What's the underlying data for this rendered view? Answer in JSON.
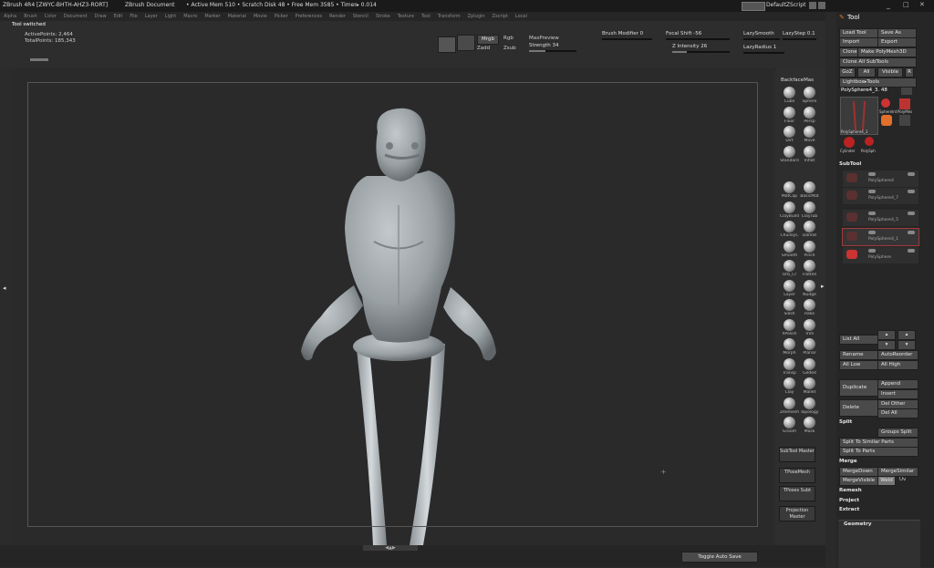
{
  "titlebar": {
    "app": "ZBrush 4R4 [ZWYC-BHTH-AHZ3-RORT]",
    "document": "ZBrush Document",
    "stats": "• Active Mem 510 • Scratch Disk 48 • Free Mem 3585 • Timer▸ 0.014",
    "script_label": "DefaultZScript"
  },
  "menu": [
    "Alpha",
    "Brush",
    "Color",
    "Document",
    "Draw",
    "Edit",
    "File",
    "Layer",
    "Light",
    "Macro",
    "Marker",
    "Material",
    "Movie",
    "Picker",
    "Preferences",
    "Render",
    "Stencil",
    "Stroke",
    "Texture",
    "Tool",
    "Transform",
    "Zplugin",
    "Zscript",
    "Local"
  ],
  "status": {
    "message": "Tool switched",
    "active_points": "ActivePoints: 2,464",
    "total_points": "TotalPoints: 185,343"
  },
  "draw_controls": {
    "mrgb": "Mrgb",
    "rgb": "Rgb",
    "m": "M",
    "zadd": "Zadd",
    "zsub": "Zsub",
    "max_preview": "MaxPreview",
    "strength_label": "Strength",
    "strength_value": "34",
    "brush_modifier_label": "Brush Modifier",
    "brush_modifier_value": "0",
    "focal_shift_label": "Focal Shift",
    "focal_shift_value": "-56",
    "z_intensity_label": "Z Intensity",
    "z_intensity_value": "26",
    "lazy_smooth": "LazySmooth",
    "lazy_step_label": "LazyStep",
    "lazy_step_value": "0.1",
    "lazy_radius_label": "LazyRadius",
    "lazy_radius_value": "1",
    "strength_level": 0.34,
    "z_intensity_level": 0.26
  },
  "materials": {
    "header": "BackfaceMas",
    "items": [
      "Cube",
      "Sphere",
      "Floor",
      "Persp",
      "Dirt",
      "Move",
      "Standard",
      "Inflat",
      "MatCap",
      "BasicMat",
      "ClayBuild",
      "ClayTub",
      "ChunkyC",
      "DamSt",
      "Smooth",
      "Pinch",
      "Orb_Cr",
      "Flatten",
      "Layer",
      "Nudge",
      "Slash",
      "Rake",
      "hPolish",
      "Trim",
      "Morph",
      "Planar",
      "Transp",
      "Gilded",
      "Clay",
      "Mallet",
      "ZRemesh",
      "Topology",
      "Groom",
      "Mask"
    ],
    "buttons": [
      "SubTool Master",
      "TPoseMesh",
      "TPoses Subt",
      "Projection Master"
    ]
  },
  "bottom": {
    "toggle_auto_save": "Toggle Auto Save",
    "nav_arrows": "◀▲▶"
  },
  "tool_panel": {
    "title": "Tool",
    "load_tool": "Load Tool",
    "save_as": "Save As",
    "import": "Import",
    "export": "Export",
    "clone": "Clone",
    "make_polymesh": "Make PolyMesh3D",
    "clone_all_subtools": "Clone All SubTools",
    "goz": "GoZ",
    "all": "All",
    "visible": "Visible",
    "r": "R",
    "lightbox_tools": "Lightbox▸Tools",
    "current_tool": "PolySphere4_3. 48",
    "tool_thumbs": [
      "PolySphere4_3",
      "SphereInt",
      "PolyMes",
      "Cylinder",
      "PolySph"
    ],
    "subtool_title": "SubTool",
    "subtools": [
      "PolySphere4",
      "PolySphere4_7",
      "PolySphere4_5",
      "PolySphere4_1",
      "PolySphere"
    ],
    "list_all": "List All",
    "rename": "Rename",
    "auto_reorder": "AutoReorder",
    "all_low": "All Low",
    "all_high": "All High",
    "duplicate": "Duplicate",
    "append": "Append",
    "insert": "Insert",
    "delete": "Delete",
    "del_other": "Del Other",
    "del_all": "Del All",
    "split_title": "Split",
    "groups_split": "Groups Split",
    "split_similar": "Split To Similar Parts",
    "split_parts": "Split To Parts",
    "merge_title": "Merge",
    "merge_down": "MergeDown",
    "merge_similar": "MergeSimilar",
    "merge_visible": "MergeVisible",
    "weld": "Weld",
    "uv": "Uv",
    "remesh": "Remesh",
    "project": "Project",
    "extract": "Extract",
    "geometry": "Geometry"
  },
  "colors": {
    "accent_orange": "#e0702a",
    "selection_red": "#a03a3a",
    "model_gray": "#9da4a8"
  }
}
